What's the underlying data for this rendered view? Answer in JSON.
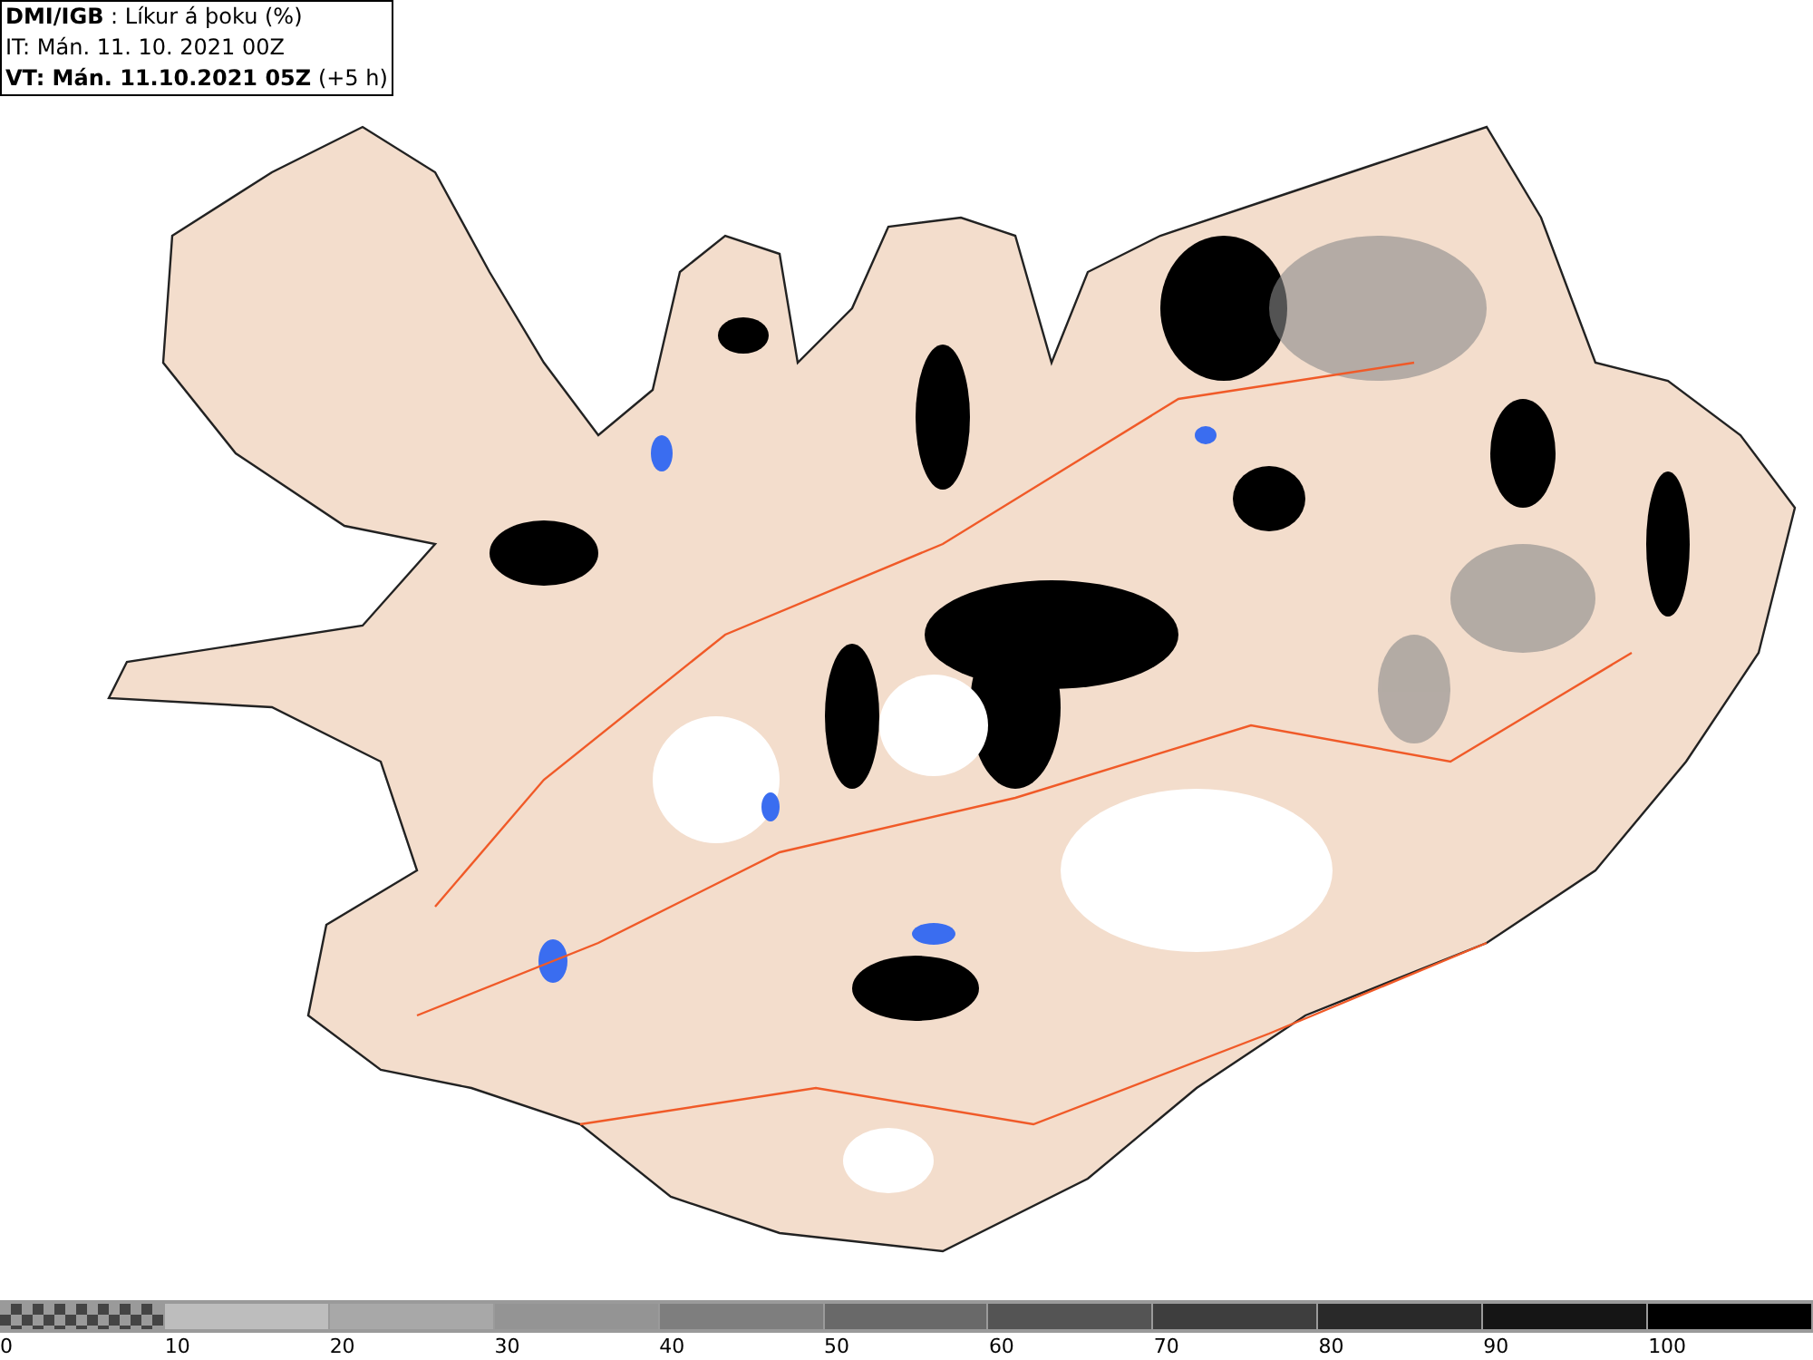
{
  "header": {
    "source": "DMI/IGB",
    "title": ": Líkur á þoku (%)",
    "issue_time": "IT: Mán. 11. 10. 2021 00Z",
    "valid_time": "VT: Mán. 11.10.2021 05Z",
    "valid_offset": "(+5 h)"
  },
  "legend": [
    {
      "kind": "checker",
      "label": "0"
    },
    {
      "kind": "solid",
      "color": "#bdbdbd",
      "label": "10"
    },
    {
      "kind": "solid",
      "color": "#a8a8a8",
      "label": "20"
    },
    {
      "kind": "solid",
      "color": "#949494",
      "label": "30"
    },
    {
      "kind": "solid",
      "color": "#7e7e7e",
      "label": "40"
    },
    {
      "kind": "solid",
      "color": "#696969",
      "label": "50"
    },
    {
      "kind": "solid",
      "color": "#545454",
      "label": "60"
    },
    {
      "kind": "solid",
      "color": "#3e3e3e",
      "label": "70"
    },
    {
      "kind": "solid",
      "color": "#292929",
      "label": "80"
    },
    {
      "kind": "solid",
      "color": "#151515",
      "label": "90"
    },
    {
      "kind": "solid",
      "color": "#000000",
      "label": "100"
    }
  ]
}
